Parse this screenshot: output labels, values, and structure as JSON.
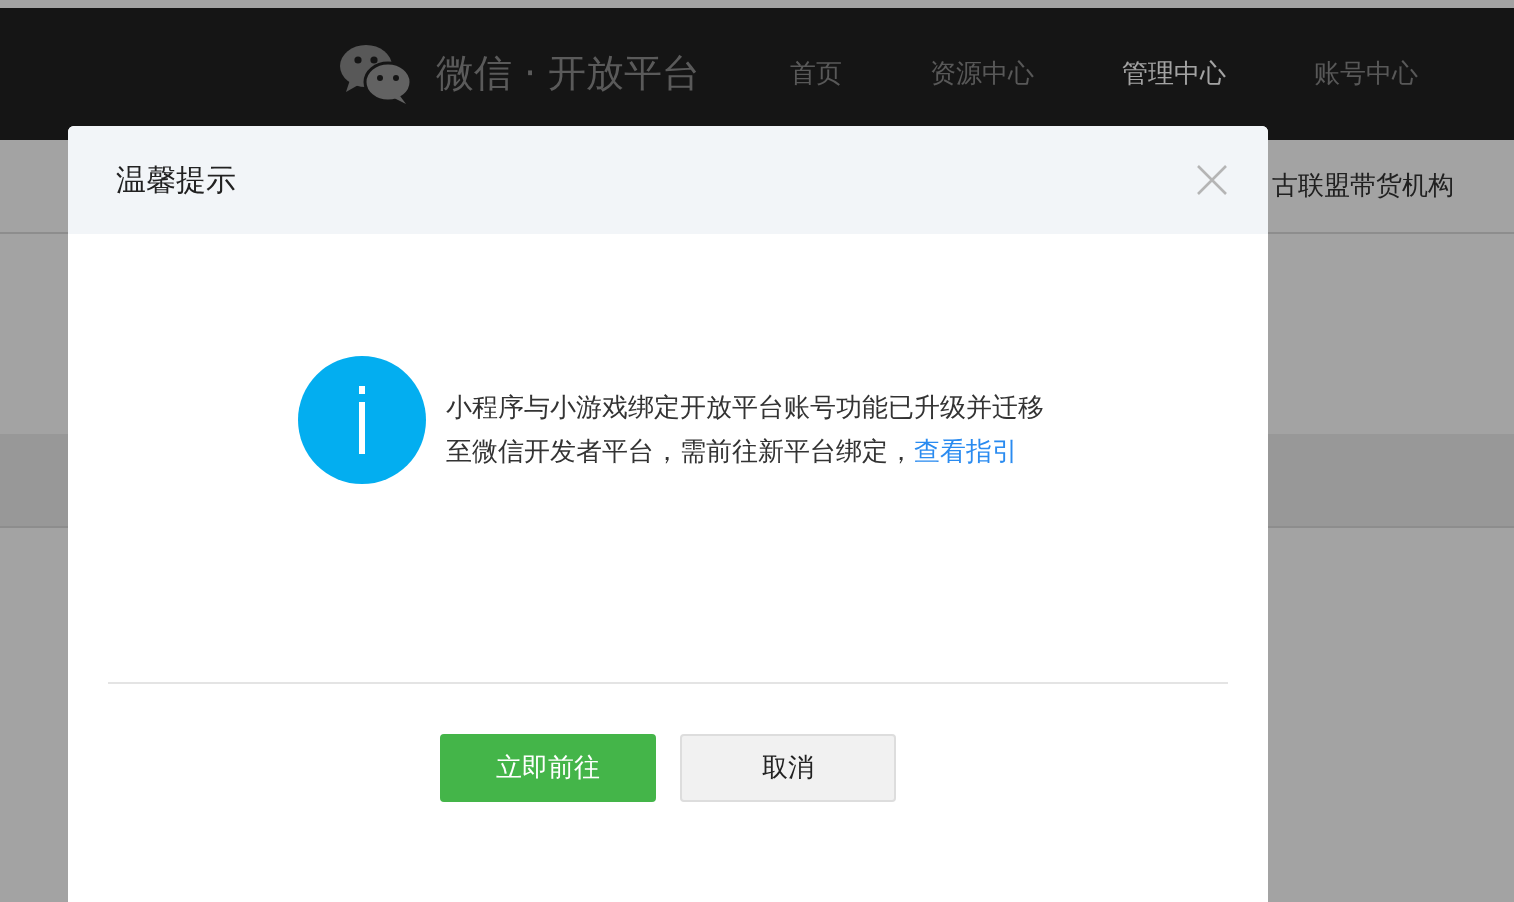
{
  "navbar": {
    "brand": "微信 · 开放平台",
    "items": [
      {
        "label": "首页",
        "selected": false
      },
      {
        "label": "资源中心",
        "selected": false
      },
      {
        "label": "管理中心",
        "selected": true
      },
      {
        "label": "账号中心",
        "selected": false
      }
    ]
  },
  "subnav": {
    "items": [
      "古联盟带货机构"
    ]
  },
  "dialog": {
    "title": "温馨提示",
    "message": "小程序与小游戏绑定开放平台账号功能已升级并迁移至微信开发者平台，需前往新平台绑定，",
    "link": "查看指引",
    "buttons": [
      {
        "label": "立即前往",
        "kind": "primary"
      },
      {
        "label": "取消",
        "kind": "default"
      }
    ]
  }
}
